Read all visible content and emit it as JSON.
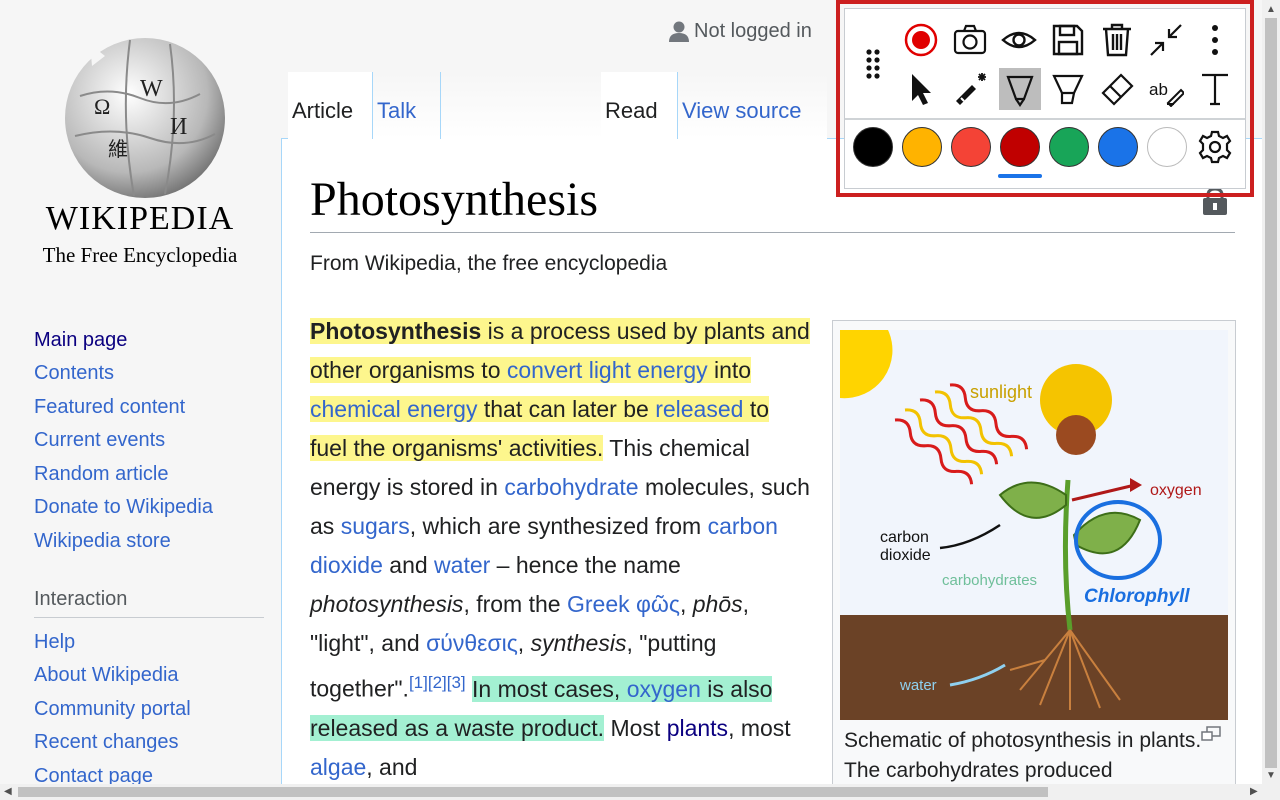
{
  "header": {
    "user_status": "Not logged in"
  },
  "logo": {
    "wordmark": "WIKIPEDIA",
    "tagline": "The Free Encyclopedia"
  },
  "sidebar": {
    "nav_items": [
      "Main page",
      "Contents",
      "Featured content",
      "Current events",
      "Random article",
      "Donate to Wikipedia",
      "Wikipedia store"
    ],
    "interaction_heading": "Interaction",
    "interaction_items": [
      "Help",
      "About Wikipedia",
      "Community portal",
      "Recent changes",
      "Contact page"
    ]
  },
  "tabs": {
    "article": "Article",
    "talk": "Talk",
    "read": "Read",
    "view_source": "View source"
  },
  "article": {
    "title": "Photosynthesis",
    "from": "From Wikipedia, the free encyclopedia",
    "p": {
      "t1": "Photosynthesis",
      "t2": " is a process used by plants and other organisms to ",
      "l1": "convert",
      "t3": " ",
      "l2": "light energy",
      "t4": " into ",
      "l3": "chemical energy",
      "t5": " that can later be ",
      "l4": "released",
      "t6": " to fuel the organisms' activities.",
      "t7": " This chemical energy is stored in ",
      "l5": "carbohydrate",
      "t8": " molecules, such as ",
      "l6": "sugars",
      "t9": ", which are synthesized from ",
      "l7": "carbon dioxide",
      "t10": " and ",
      "l8": "water",
      "t11": " – hence the name ",
      "t12": "photosynthesis",
      "t13": ", from the ",
      "l9": "Greek",
      "t14": " ",
      "l10": "φῶς",
      "t15": ", ",
      "t16": "phōs",
      "t17": ", \"light\", and ",
      "l11": "σύνθεσις",
      "t18": ", ",
      "t19": "synthesis",
      "t20": ", \"putting together\".",
      "ref": "[1][2][3]",
      "t21": "In most cases, ",
      "l12": "oxygen",
      "t22": " is also released as a waste product.",
      "t23": " Most ",
      "l13": "plants",
      "t24": ", most ",
      "l14": "algae",
      "t25": ", and"
    },
    "figure": {
      "sunlight": "sunlight",
      "oxygen": "oxygen",
      "carbon": "carbon",
      "dioxide": "dioxide",
      "carbohydrates": "carbohydrates",
      "chlorophyll": "Chlorophyll",
      "water": "water",
      "caption": "Schematic of photosynthesis in plants. The carbohydrates produced"
    }
  },
  "toolbar": {
    "icons": [
      "drag-handle-icon",
      "record-icon",
      "camera-icon",
      "eye-icon",
      "save-icon",
      "trash-icon",
      "collapse-icon",
      "more-vertical-icon",
      "pointer-icon",
      "laser-pointer-icon",
      "pen-icon",
      "highlighter-icon",
      "eraser-icon",
      "text-highlight-icon",
      "text-tool-icon",
      "settings-icon"
    ],
    "colors": [
      "#000000",
      "#ffb300",
      "#f44336",
      "#c00000",
      "#18a558",
      "#1a73e8",
      "#ffffff"
    ],
    "selected_color": "#c00000",
    "text_tool_label": "ab"
  }
}
